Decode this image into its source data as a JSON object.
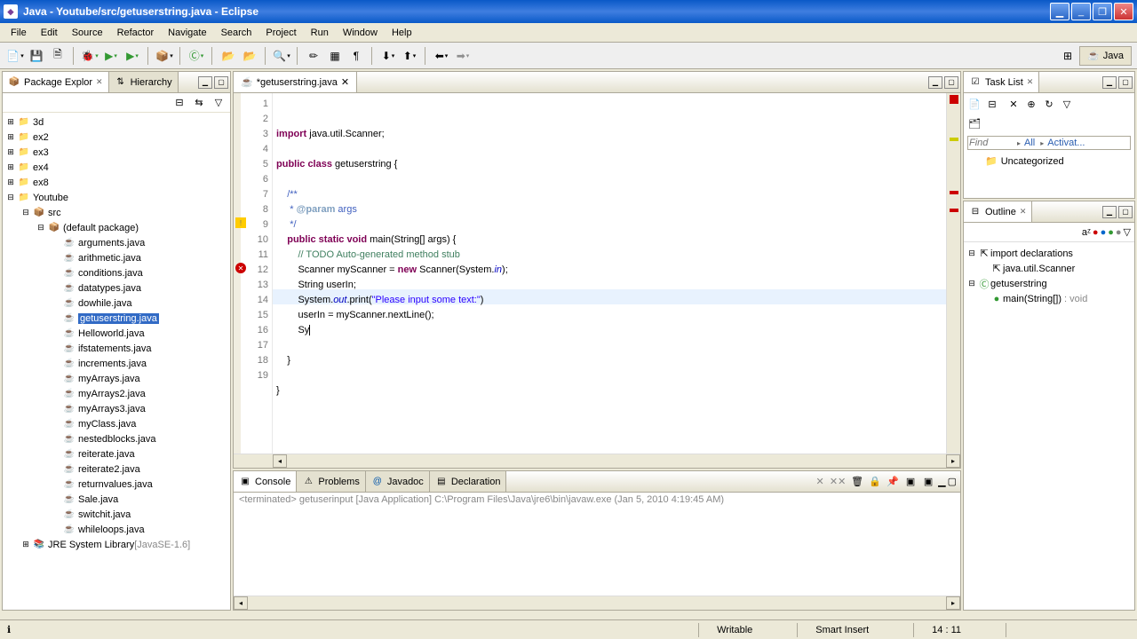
{
  "window": {
    "title": "Java - Youtube/src/getuserstring.java - Eclipse"
  },
  "menu": [
    "File",
    "Edit",
    "Source",
    "Refactor",
    "Navigate",
    "Search",
    "Project",
    "Run",
    "Window",
    "Help"
  ],
  "perspective": "Java",
  "left_tabs": {
    "active": "Package Explor",
    "inactive": "Hierarchy"
  },
  "tree": {
    "projects": [
      {
        "name": "3d",
        "exp": false
      },
      {
        "name": "ex2",
        "exp": false
      },
      {
        "name": "ex3",
        "exp": false
      },
      {
        "name": "ex4",
        "exp": false
      },
      {
        "name": "ex8",
        "exp": false
      },
      {
        "name": "Youtube",
        "exp": true
      }
    ],
    "src_label": "src",
    "pkg_label": "(default package)",
    "files": [
      "arguments.java",
      "arithmetic.java",
      "conditions.java",
      "datatypes.java",
      "dowhile.java",
      "getuserstring.java",
      "Helloworld.java",
      "ifstatements.java",
      "increments.java",
      "myArrays.java",
      "myArrays2.java",
      "myArrays3.java",
      "myClass.java",
      "nestedblocks.java",
      "reiterate.java",
      "reiterate2.java",
      "returnvalues.java",
      "Sale.java",
      "switchit.java",
      "whileloops.java"
    ],
    "selected": "getuserstring.java",
    "jre": "JRE System Library",
    "jre_ver": "[JavaSE-1.6]"
  },
  "editor": {
    "tab_title": "getuserstring.java",
    "dirty": true,
    "lines": 19,
    "cursor_line": 14,
    "text": {
      "l1a": "import",
      "l1b": " java.util.Scanner;",
      "l3a": "public class",
      "l3b": " getuserstring {",
      "l5": "    /**",
      "l6a": "     * ",
      "l6b": "@param",
      "l6c": " args",
      "l7": "     */",
      "l8a": "    public static void",
      "l8b": " main(String[] args) {",
      "l9a": "        ",
      "l9b": "// TODO Auto-generated method stub",
      "l10a": "        Scanner myScanner = ",
      "l10b": "new",
      "l10c": " Scanner(System.",
      "l10d": "in",
      "l10e": ");",
      "l11": "        String userIn;",
      "l12a": "        System.",
      "l12b": "out",
      "l12c": ".print(",
      "l12d": "\"Please input some text:\"",
      "l12e": ")",
      "l13": "        userIn = myScanner.nextLine();",
      "l14": "        Sy",
      "l16": "    }",
      "l18": "}"
    }
  },
  "bottom_tabs": [
    "Console",
    "Problems",
    "Javadoc",
    "Declaration"
  ],
  "console_desc": "<terminated> getuserinput [Java Application] C:\\Program Files\\Java\\jre6\\bin\\javaw.exe (Jan 5, 2010 4:19:45 AM)",
  "tasklist": {
    "title": "Task List",
    "find": "Find",
    "all": "All",
    "act": "Activat...",
    "uncat": "Uncategorized"
  },
  "outline": {
    "title": "Outline",
    "imports": "import declarations",
    "scanner": "java.util.Scanner",
    "class": "getuserstring",
    "method": "main(String[])",
    "ret": ": void"
  },
  "status": {
    "writable": "Writable",
    "insert": "Smart Insert",
    "pos": "14 : 11"
  }
}
